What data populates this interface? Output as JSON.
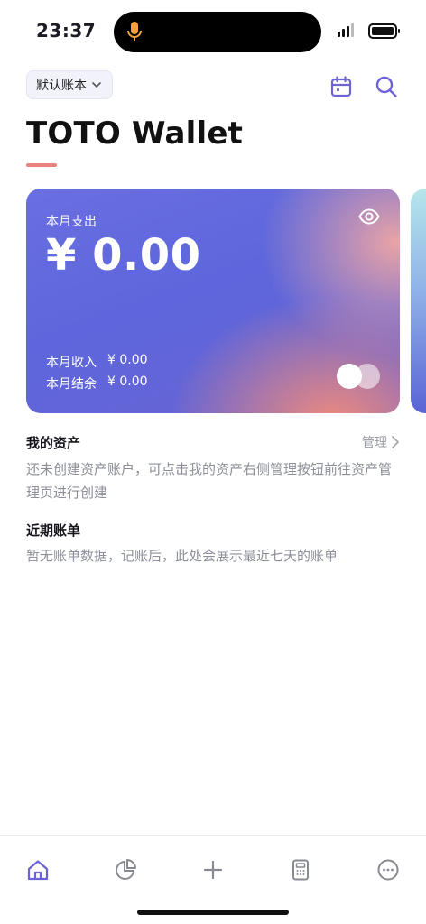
{
  "status": {
    "time": "23:37"
  },
  "header": {
    "ledger_label": "默认账本",
    "app_title": "TOTO Wallet"
  },
  "colors": {
    "accent": "#6c63d6",
    "title_underline": "#e8847a",
    "muted_text": "#8c8f99"
  },
  "card": {
    "expense_label": "本月支出",
    "expense_amount": "¥ 0.00",
    "income_label": "本月收入",
    "income_value": "¥ 0.00",
    "balance_label": "本月结余",
    "balance_value": "¥ 0.00"
  },
  "assets": {
    "title": "我的资产",
    "manage_label": "管理",
    "empty_text": "还未创建资产账户，可点击我的资产右侧管理按钮前往资产管理页进行创建"
  },
  "recent": {
    "title": "近期账单",
    "empty_text": "暂无账单数据，记账后，此处会展示最近七天的账单"
  },
  "tabs": [
    {
      "icon": "home-icon"
    },
    {
      "icon": "pie-chart-icon"
    },
    {
      "icon": "plus-icon"
    },
    {
      "icon": "calculator-icon"
    },
    {
      "icon": "more-icon"
    }
  ]
}
